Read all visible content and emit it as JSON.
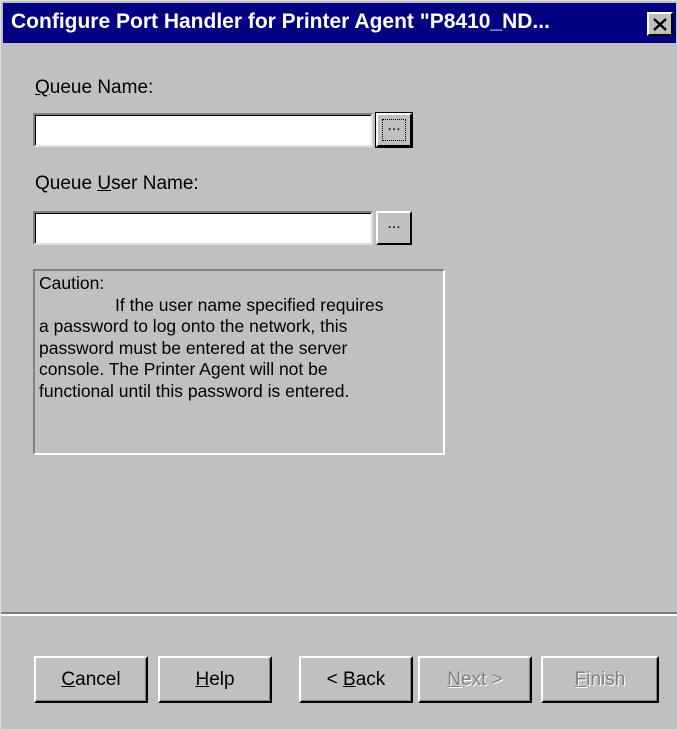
{
  "window": {
    "title": "Configure Port Handler for Printer Agent \"P8410_ND...",
    "close_icon": "close-icon"
  },
  "queue_name": {
    "label_mnemonic": "Q",
    "label_rest": "ueue Name:",
    "value": "",
    "browse_label": "..."
  },
  "queue_user": {
    "label_before": "Queue ",
    "label_mnemonic": "U",
    "label_rest": "ser Name:",
    "value": "",
    "browse_label": "..."
  },
  "caution": {
    "heading": "Caution:",
    "line1": "If the user name specified requires",
    "line2": "a password to log onto the network, this",
    "line3": "password must be entered at the server",
    "line4": "console.  The Printer Agent will not be",
    "line5": "functional until this password is entered."
  },
  "buttons": {
    "cancel_mnemonic": "C",
    "cancel_rest": "ancel",
    "help_mnemonic": "H",
    "help_rest": "elp",
    "back_before": "< ",
    "back_mnemonic": "B",
    "back_rest": "ack",
    "next_mnemonic": "N",
    "next_rest": "ext >",
    "finish_mnemonic": "F",
    "finish_rest": "inish"
  },
  "colors": {
    "titlebar": "#000080",
    "face": "#c0c0c0",
    "disabled_text": "#808080"
  }
}
